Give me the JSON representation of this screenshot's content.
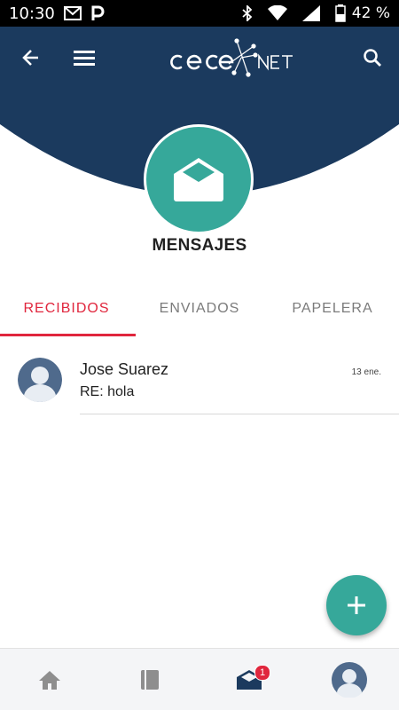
{
  "status_bar": {
    "time": "10:30",
    "battery": "42 %",
    "icons": [
      "gmail-icon",
      "parking-icon",
      "bluetooth-icon",
      "wifi-icon",
      "signal-icon",
      "battery-icon"
    ]
  },
  "app_bar": {
    "logo_text": "CEOE NET",
    "back_icon": "arrow-back-icon",
    "menu_icon": "hamburger-menu-icon",
    "search_icon": "search-icon"
  },
  "page": {
    "title": "MENSAJES",
    "icon": "open-envelope-icon"
  },
  "tabs": [
    {
      "label": "RECIBIDOS",
      "active": true
    },
    {
      "label": "ENVIADOS",
      "active": false
    },
    {
      "label": "PAPELERA",
      "active": false
    }
  ],
  "messages": [
    {
      "sender": "Jose Suarez",
      "subject": "RE: hola",
      "date": "13 ene."
    }
  ],
  "fab": {
    "icon": "plus-icon"
  },
  "bottom_nav": [
    {
      "name": "home",
      "icon": "home-icon"
    },
    {
      "name": "book",
      "icon": "book-icon"
    },
    {
      "name": "messages",
      "icon": "envelope-icon",
      "badge": "1"
    },
    {
      "name": "profile",
      "icon": "avatar-icon"
    }
  ],
  "colors": {
    "primary": "#1b3a5e",
    "accent": "#36a89a",
    "active_tab": "#e0263d",
    "badge": "#e0263d"
  }
}
